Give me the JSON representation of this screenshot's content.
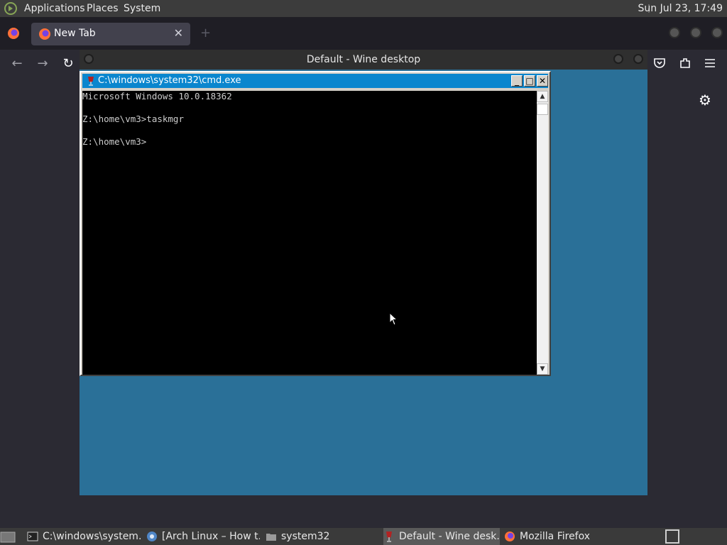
{
  "top_panel": {
    "menus": [
      "Applications",
      "Places",
      "System"
    ],
    "clock": "Sun Jul 23, 17:49"
  },
  "firefox": {
    "tab_label": "New Tab",
    "tab_close": "✕",
    "new_tab": "+",
    "icons": [
      "firefox-logo-icon",
      "back-arrow-icon",
      "forward-arrow-icon",
      "reload-icon",
      "pocket-icon",
      "extensions-icon",
      "hamburger-menu-icon",
      "settings-gear-icon"
    ]
  },
  "wine": {
    "title": "Default - Wine desktop"
  },
  "cmd": {
    "title": "C:\\windows\\system32\\cmd.exe",
    "lines": [
      "Microsoft Windows 10.0.18362",
      "",
      "Z:\\home\\vm3>taskmgr",
      "",
      "Z:\\home\\vm3>"
    ],
    "minimize": "_",
    "maximize": "□",
    "close": "✕"
  },
  "taskbar": {
    "tasks": [
      {
        "label": "C:\\windows\\system...",
        "icon": "terminal-icon"
      },
      {
        "label": "[Arch Linux – How t...",
        "icon": "chromium-icon"
      },
      {
        "label": "system32",
        "icon": "folder-icon"
      },
      {
        "label": "Default - Wine desk...",
        "icon": "wine-glass-icon"
      },
      {
        "label": "Mozilla Firefox",
        "icon": "firefox-icon"
      }
    ]
  },
  "colors": {
    "wine_desktop": "#2a7098",
    "cmd_titlebar": "#0a86ce",
    "panel": "#3c3c3c"
  }
}
